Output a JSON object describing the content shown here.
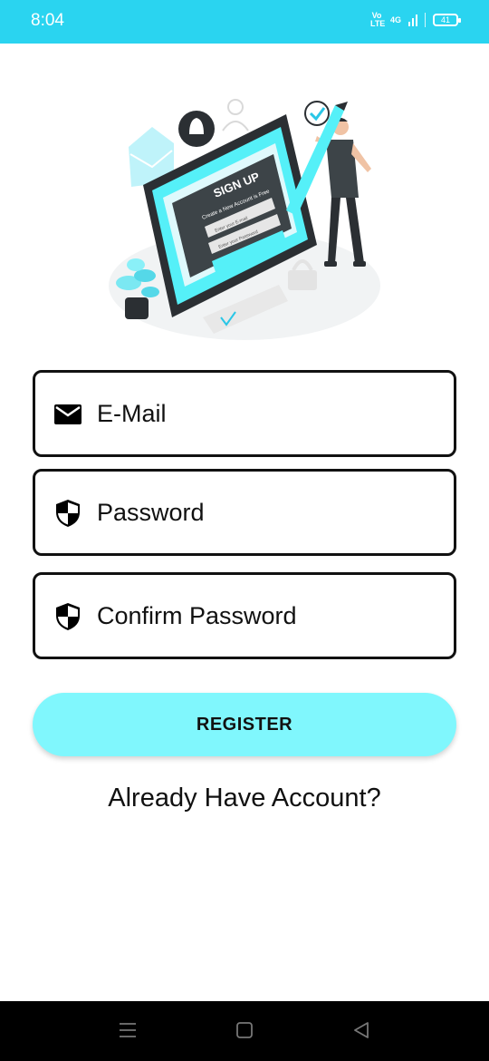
{
  "status_bar": {
    "time": "8:04",
    "volte_top": "Vo",
    "volte_bottom": "LTE",
    "network": "4G",
    "battery": "41",
    "background_color": "#2ad4f0"
  },
  "illustration": {
    "title": "SIGN UP",
    "subtitle": "Create a New Account is Free",
    "field1": "Enter your E-mail",
    "field2": "Enter your Password",
    "icons": [
      "mail-icon",
      "bell-icon",
      "user-icon",
      "check-icon",
      "lock-icon",
      "plant-icon"
    ]
  },
  "form": {
    "email": {
      "label": "E-Mail",
      "icon": "mail-icon"
    },
    "password": {
      "label": "Password",
      "icon": "shield-icon"
    },
    "confirm_password": {
      "label": "Confirm Password",
      "icon": "shield-icon"
    }
  },
  "register_button": {
    "label": "REGISTER",
    "color": "#80f7fd"
  },
  "login_link": "Already Have Account?",
  "nav_bar": {
    "buttons": [
      "menu-icon",
      "home-icon",
      "back-icon"
    ]
  }
}
